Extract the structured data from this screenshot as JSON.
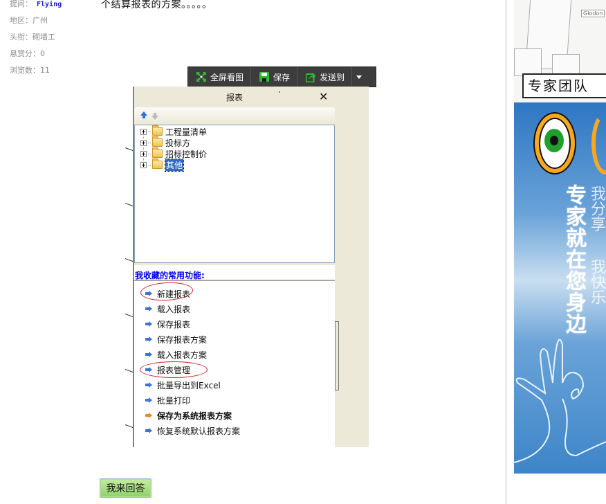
{
  "user_info": {
    "asker_label": "提问：",
    "asker_name": "Flying",
    "region": "地区：广州",
    "title": "头衔：砌墙工",
    "bounty": "悬赏分：0",
    "views": "浏览数：11"
  },
  "question": {
    "text_tail": "个结算报表的方案。。。。。"
  },
  "image_toolbar": {
    "fullscreen_label": "全屏看图",
    "fullscreen_icon": "expand-arrows-icon",
    "save_label": "保存",
    "save_icon": "floppy-disk-icon",
    "send_label": "发送到",
    "send_icon": "share-export-icon",
    "dropdown_icon": "caret-down-icon",
    "icon_color": "#2ebd2e"
  },
  "screenshot": {
    "panel_title": "报表",
    "close_icon": "close-x-icon",
    "nav": {
      "up_icon": "arrow-up-icon",
      "down_icon": "arrow-down-icon"
    },
    "tree_items": [
      {
        "label": "工程量清单",
        "selected": false
      },
      {
        "label": "投标方",
        "selected": false
      },
      {
        "label": "招标控制价",
        "selected": false
      },
      {
        "label": "其他",
        "selected": true
      }
    ],
    "favorites_title": "我收藏的常用功能:",
    "favorites": [
      {
        "label": "新建报表",
        "circled": true
      },
      {
        "label": "载入报表"
      },
      {
        "label": "保存报表"
      },
      {
        "label": "保存报表方案"
      },
      {
        "label": "载入报表方案"
      },
      {
        "label": "报表管理",
        "circled": true
      },
      {
        "label": "批量导出到Excel"
      },
      {
        "label": "批量打印"
      },
      {
        "label": "保存为系统报表方案",
        "bold": true,
        "arrow_color": "orange"
      },
      {
        "label": "恢复系统默认报表方案"
      }
    ],
    "accent_blue": "#0000ee",
    "selection_color": "#316ac5",
    "circle_color": "#d42020"
  },
  "answer_button": {
    "label": "我来回答"
  },
  "banner": {
    "team_label": "专家团队",
    "logo_text": "Glodon",
    "slogan_main": "专家就在您身边",
    "slogan_side1": "我分享",
    "slogan_side2": "我快乐"
  }
}
